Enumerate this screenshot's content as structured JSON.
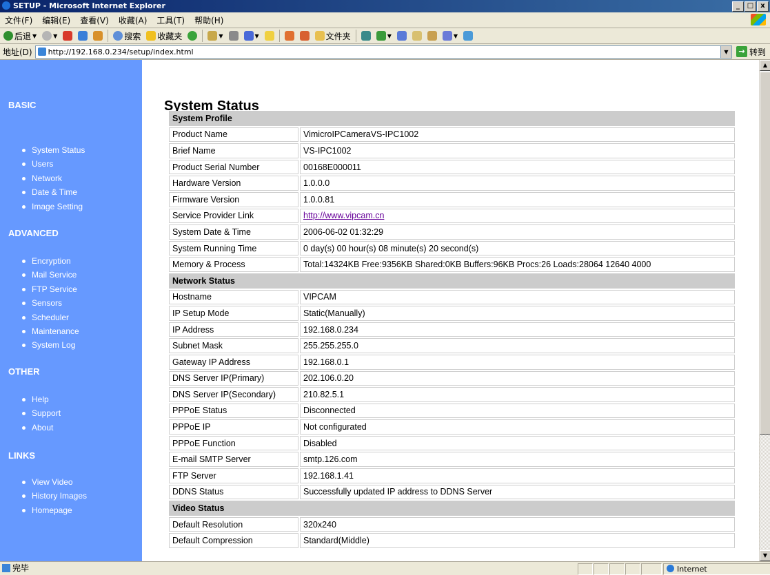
{
  "window": {
    "title": "SETUP - Microsoft Internet Explorer",
    "buttons": [
      "_",
      "□",
      "x"
    ]
  },
  "menu": [
    "文件(F)",
    "编辑(E)",
    "查看(V)",
    "收藏(A)",
    "工具(T)",
    "帮助(H)"
  ],
  "toolbar": {
    "back": "后退",
    "search": "搜索",
    "favorites": "收藏夹",
    "folders": "文件夹"
  },
  "address": {
    "label": "地址(D)",
    "url": "http://192.168.0.234/setup/index.html",
    "go": "转到"
  },
  "sidebar": {
    "sections": [
      {
        "title": "BASIC",
        "items": [
          "System Status",
          "Users",
          "Network",
          "Date & Time",
          "Image Setting"
        ]
      },
      {
        "title": "ADVANCED",
        "items": [
          "Encryption",
          "Mail Service",
          "FTP Service",
          "Sensors",
          "Scheduler",
          "Maintenance",
          "System Log"
        ]
      },
      {
        "title": "OTHER",
        "items": [
          "Help",
          "Support",
          "About"
        ]
      },
      {
        "title": "LINKS",
        "items": [
          "View Video",
          "History Images",
          "Homepage"
        ]
      }
    ]
  },
  "page": {
    "title": "System Status"
  },
  "status_table": [
    {
      "header": "System Profile"
    },
    {
      "key": "Product Name",
      "value": "VimicroIPCameraVS-IPC1002"
    },
    {
      "key": "Brief Name",
      "value": "VS-IPC1002"
    },
    {
      "key": "Product Serial Number",
      "value": "00168E000011"
    },
    {
      "key": "Hardware Version",
      "value": "1.0.0.0"
    },
    {
      "key": "Firmware Version",
      "value": "1.0.0.81"
    },
    {
      "key": "Service Provider Link",
      "value": "http://www.vipcam.cn",
      "link": true
    },
    {
      "key": "System Date & Time",
      "value": "2006-06-02 01:32:29"
    },
    {
      "key": "System Running Time",
      "value": "0 day(s) 00 hour(s) 08 minute(s) 20 second(s)"
    },
    {
      "key": "Memory & Process",
      "value": "Total:14324KB Free:9356KB Shared:0KB Buffers:96KB Procs:26 Loads:28064 12640 4000"
    },
    {
      "header": "Network Status"
    },
    {
      "key": "Hostname",
      "value": "VIPCAM"
    },
    {
      "key": "IP Setup Mode",
      "value": "Static(Manually)"
    },
    {
      "key": "IP Address",
      "value": "192.168.0.234"
    },
    {
      "key": "Subnet Mask",
      "value": "255.255.255.0"
    },
    {
      "key": "Gateway IP Address",
      "value": "192.168.0.1"
    },
    {
      "key": "DNS Server IP(Primary)",
      "value": "202.106.0.20"
    },
    {
      "key": "DNS Server IP(Secondary)",
      "value": "210.82.5.1"
    },
    {
      "key": "PPPoE Status",
      "value": "Disconnected"
    },
    {
      "key": "PPPoE IP",
      "value": "Not configurated"
    },
    {
      "key": "PPPoE Function",
      "value": "Disabled"
    },
    {
      "key": "E-mail SMTP Server",
      "value": "smtp.126.com"
    },
    {
      "key": "FTP Server",
      "value": "192.168.1.41"
    },
    {
      "key": "DDNS Status",
      "value": "Successfully updated IP address to DDNS Server"
    },
    {
      "header": "Video Status"
    },
    {
      "key": "Default Resolution",
      "value": "320x240"
    },
    {
      "key": "Default Compression",
      "value": "Standard(Middle)"
    }
  ],
  "statusbar": {
    "text": "完毕",
    "zone": "Internet"
  },
  "colors": {
    "sidebar": "#6699ff",
    "header_row": "#cccccc",
    "link": "#660099"
  }
}
